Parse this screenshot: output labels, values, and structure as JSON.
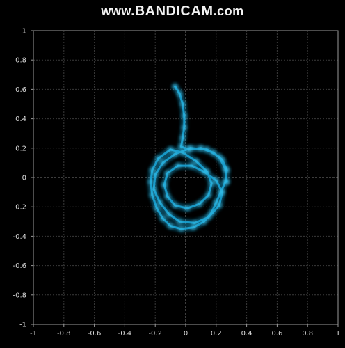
{
  "watermark": {
    "prefix": "www.",
    "brand": "BANDICAM",
    "suffix": ".com"
  },
  "chart_data": {
    "type": "scatter",
    "title": "",
    "xlabel": "",
    "ylabel": "",
    "xlim": [
      -1,
      1
    ],
    "ylim": [
      -1,
      1
    ],
    "grid": true,
    "xticks": [
      "-1",
      "-0.8",
      "-0.6",
      "-0.4",
      "-0.2",
      "0",
      "0.2",
      "0.4",
      "0.6",
      "0.8",
      "1"
    ],
    "yticks": [
      "1",
      "0.8",
      "0.6",
      "0.4",
      "0.2",
      "0",
      "-0.2",
      "-0.4",
      "-0.6",
      "-0.8",
      "-1"
    ],
    "trajectory_color": "#1aa6d8",
    "trajectory": [
      [
        -0.07,
        0.62
      ],
      [
        -0.04,
        0.57
      ],
      [
        -0.02,
        0.5
      ],
      [
        -0.01,
        0.42
      ],
      [
        -0.01,
        0.34
      ],
      [
        -0.02,
        0.27
      ],
      [
        -0.03,
        0.21
      ],
      [
        0.02,
        0.19
      ],
      [
        0.1,
        0.2
      ],
      [
        0.18,
        0.17
      ],
      [
        0.24,
        0.12
      ],
      [
        0.27,
        0.05
      ],
      [
        0.26,
        -0.03
      ],
      [
        0.23,
        -0.1
      ],
      [
        0.2,
        -0.17
      ],
      [
        0.17,
        -0.24
      ],
      [
        0.12,
        -0.3
      ],
      [
        0.05,
        -0.34
      ],
      [
        -0.03,
        -0.35
      ],
      [
        -0.1,
        -0.33
      ],
      [
        -0.15,
        -0.28
      ],
      [
        -0.19,
        -0.21
      ],
      [
        -0.22,
        -0.12
      ],
      [
        -0.23,
        -0.03
      ],
      [
        -0.22,
        0.05
      ],
      [
        -0.18,
        0.13
      ],
      [
        -0.1,
        0.19
      ],
      [
        -0.02,
        0.17
      ],
      [
        0.07,
        0.11
      ],
      [
        0.14,
        0.04
      ],
      [
        0.17,
        -0.04
      ],
      [
        0.15,
        -0.12
      ],
      [
        0.09,
        -0.18
      ],
      [
        0.01,
        -0.21
      ],
      [
        -0.07,
        -0.19
      ],
      [
        -0.12,
        -0.13
      ],
      [
        -0.14,
        -0.05
      ],
      [
        -0.12,
        0.03
      ],
      [
        -0.05,
        0.08
      ],
      [
        0.04,
        0.08
      ],
      [
        0.12,
        0.04
      ],
      [
        0.2,
        -0.02
      ],
      [
        0.24,
        -0.1
      ],
      [
        0.22,
        -0.19
      ],
      [
        0.15,
        -0.27
      ],
      [
        0.06,
        -0.31
      ],
      [
        -0.04,
        -0.3
      ],
      [
        -0.11,
        -0.25
      ],
      [
        -0.17,
        -0.17
      ],
      [
        -0.21,
        -0.08
      ],
      [
        -0.2,
        0.02
      ],
      [
        -0.15,
        0.1
      ],
      [
        -0.07,
        0.16
      ],
      [
        0.03,
        0.2
      ],
      [
        0.14,
        0.19
      ],
      [
        0.22,
        0.14
      ],
      [
        0.26,
        0.06
      ],
      [
        0.27,
        -0.03
      ]
    ]
  }
}
